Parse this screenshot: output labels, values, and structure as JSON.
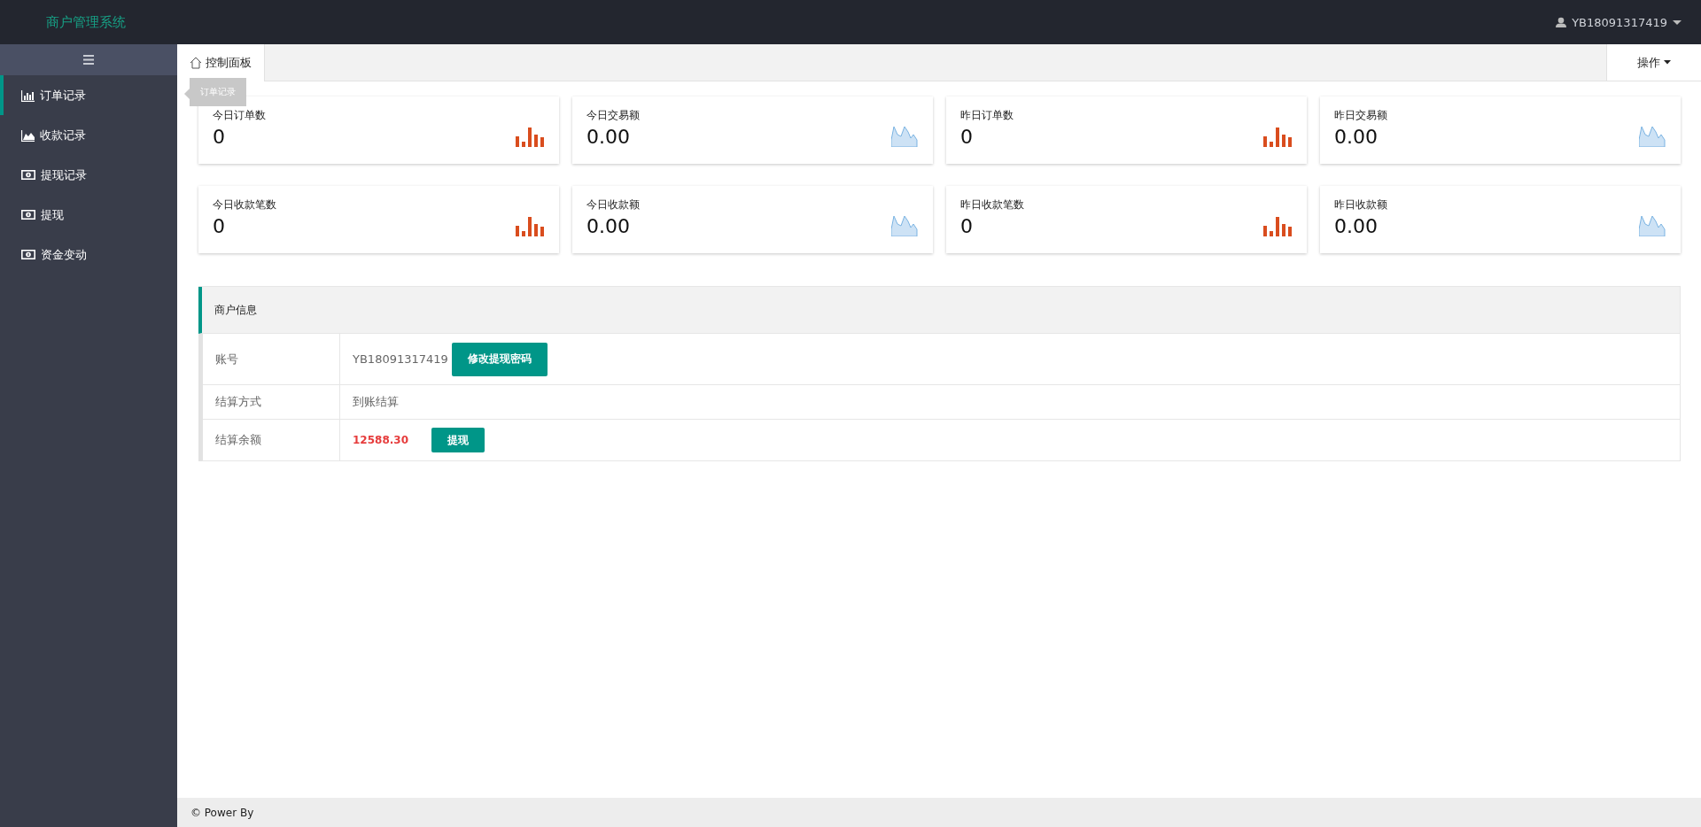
{
  "header": {
    "title": "商户管理系统",
    "user": "YB18091317419"
  },
  "sidebar": {
    "items": [
      {
        "label": "订单记录",
        "kind": "bar",
        "selected": true
      },
      {
        "label": "收款记录",
        "kind": "area",
        "selected": false
      },
      {
        "label": "提现记录",
        "kind": "money",
        "selected": false
      },
      {
        "label": "提现",
        "kind": "money",
        "selected": false
      },
      {
        "label": "资金变动",
        "kind": "money",
        "selected": false
      }
    ]
  },
  "tooltip": {
    "text": "订单记录"
  },
  "tabs": [
    {
      "label": "控制面板",
      "selected": true
    }
  ],
  "actions_menu": {
    "label": "操作"
  },
  "stats": [
    {
      "label": "今日订单数",
      "value": "0",
      "kind": "bars"
    },
    {
      "label": "今日交易额",
      "value": "0.00",
      "kind": "area"
    },
    {
      "label": "昨日订单数",
      "value": "0",
      "kind": "bars"
    },
    {
      "label": "昨日交易额",
      "value": "0.00",
      "kind": "area"
    },
    {
      "label": "今日收款笔数",
      "value": "0",
      "kind": "bars"
    },
    {
      "label": "今日收款额",
      "value": "0.00",
      "kind": "area"
    },
    {
      "label": "昨日收款笔数",
      "value": "0",
      "kind": "bars"
    },
    {
      "label": "昨日收款额",
      "value": "0.00",
      "kind": "area"
    }
  ],
  "merchant_info": {
    "title": "商户信息",
    "rows": [
      {
        "label": "账号",
        "value": "YB18091317419",
        "button": "修改提现密码",
        "kind": "plain"
      },
      {
        "label": "结算方式",
        "value": "到账结算",
        "kind": "plain"
      },
      {
        "label": "结算余额",
        "value": "12588.30",
        "button": "提现",
        "kind": "amount"
      }
    ]
  },
  "footer": {
    "text": "© Power By"
  }
}
